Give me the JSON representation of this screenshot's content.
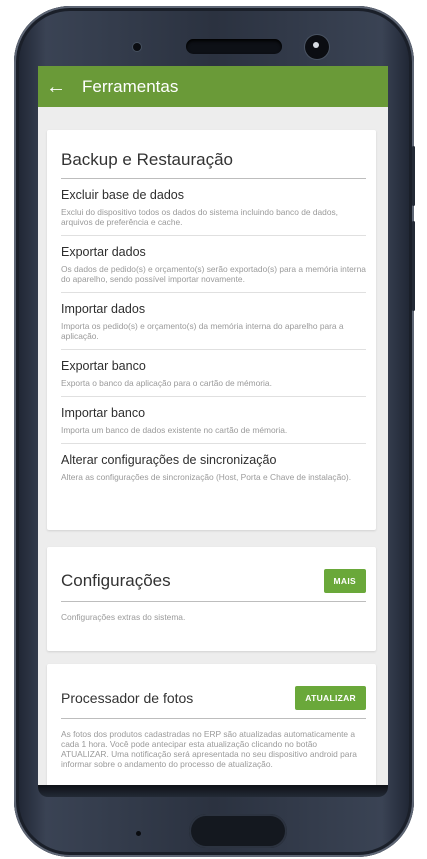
{
  "appbar": {
    "title": "Ferramentas",
    "back_icon": "arrow-left-icon"
  },
  "backup": {
    "title": "Backup e Restauração",
    "items": [
      {
        "title": "Excluir base de dados",
        "desc": "Exclui do dispositivo todos os dados do sistema incluindo banco de dados, arquivos de preferência e cache."
      },
      {
        "title": "Exportar dados",
        "desc": "Os dados de pedido(s) e orçamento(s) serão exportado(s) para a memória interna do aparelho, sendo possível importar novamente."
      },
      {
        "title": "Importar dados",
        "desc": "Importa os pedido(s) e orçamento(s) da memória interna do aparelho para a aplicação."
      },
      {
        "title": "Exportar banco",
        "desc": "Exporta o banco da aplicação para o cartão de mémoria."
      },
      {
        "title": "Importar banco",
        "desc": "Importa um banco de dados existente no cartão de mémoria."
      },
      {
        "title": "Alterar configurações de sincronização",
        "desc": "Altera as configurações de sincronização (Host, Porta e Chave de instalação)."
      }
    ]
  },
  "config": {
    "title": "Configurações",
    "button": "MAIS",
    "desc": "Configurações extras do sistema."
  },
  "fotos": {
    "title": "Processador de fotos",
    "button": "ATUALIZAR",
    "desc": "As fotos dos produtos cadastradas no ERP são atualizadas automaticamente a cada 1 hora. Você pode antecipar esta atualização clicando no botão ATUALIZAR. Uma notificação será apresentada no seu dispositivo android para informar sobre o andamento do processo de atualização."
  },
  "colors": {
    "appbar": "#6a9a38",
    "button": "#6aa83a",
    "background": "#ededed"
  }
}
